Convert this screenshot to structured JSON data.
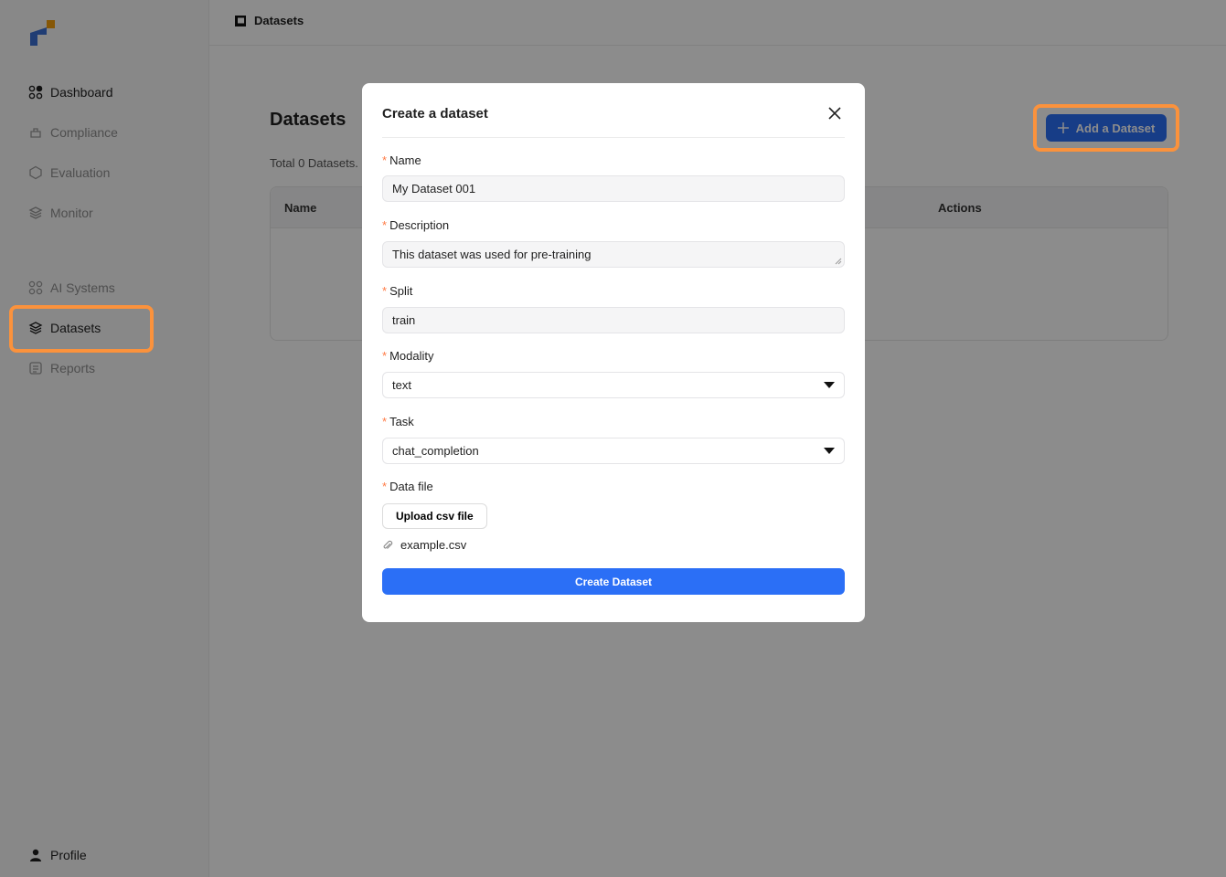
{
  "sidebar": {
    "items": [
      {
        "label": "Dashboard",
        "icon": "dashboard-icon"
      },
      {
        "label": "Compliance",
        "icon": "compliance-icon"
      },
      {
        "label": "Evaluation",
        "icon": "hexagon-icon"
      },
      {
        "label": "Monitor",
        "icon": "monitor-icon"
      },
      {
        "label": "AI Systems",
        "icon": "grid-icon"
      },
      {
        "label": "Datasets",
        "icon": "layers-icon"
      },
      {
        "label": "Reports",
        "icon": "report-icon"
      }
    ],
    "profile": "Profile"
  },
  "topbar": {
    "breadcrumb": "Datasets"
  },
  "page": {
    "title": "Datasets",
    "total": "Total 0 Datasets.",
    "add_button": "Add a Dataset",
    "table_headers": {
      "name": "Name",
      "actions": "Actions"
    }
  },
  "modal": {
    "title": "Create a dataset",
    "fields": {
      "name": {
        "label": "Name",
        "value": "My Dataset 001"
      },
      "description": {
        "label": "Description",
        "value": "This dataset was used for pre-training"
      },
      "split": {
        "label": "Split",
        "value": "train"
      },
      "modality": {
        "label": "Modality",
        "value": "text"
      },
      "task": {
        "label": "Task",
        "value": "chat_completion"
      },
      "data_file": {
        "label": "Data file"
      }
    },
    "upload_button": "Upload csv file",
    "file_name": "example.csv",
    "submit": "Create Dataset"
  },
  "colors": {
    "accent": "#2b6ff6",
    "highlight": "#fb923c",
    "required": "#ff7a45"
  }
}
